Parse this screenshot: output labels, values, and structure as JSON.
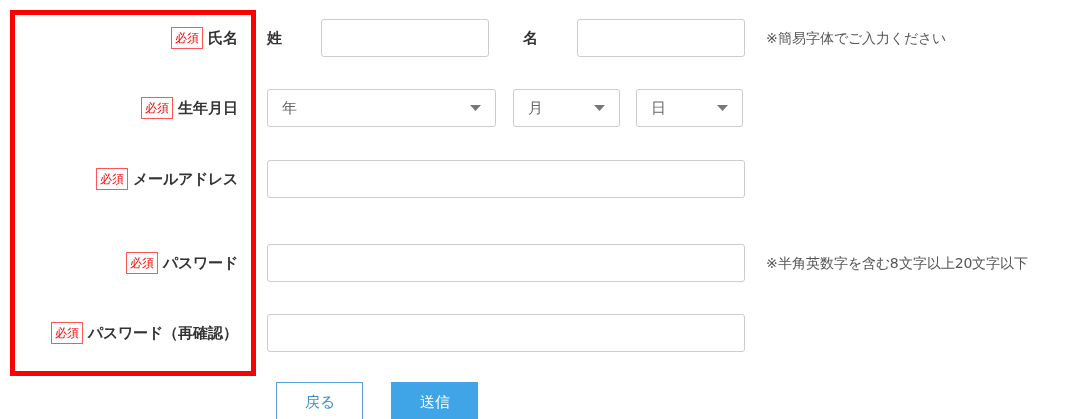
{
  "rows": [
    {
      "kind": "name",
      "required": true,
      "badge": "必須",
      "label": "氏名",
      "fields": [
        {
          "label": "姓"
        },
        {
          "label": "名"
        }
      ],
      "note": "※簡易字体でご入力ください"
    },
    {
      "kind": "date",
      "required": true,
      "badge": "必須",
      "label": "生年月日",
      "selects": [
        {
          "value": "年"
        },
        {
          "value": "月"
        },
        {
          "value": "日"
        }
      ]
    },
    {
      "kind": "text",
      "required": true,
      "badge": "必須",
      "label": "メールアドレス"
    },
    {
      "kind": "text",
      "required": true,
      "badge": "必須",
      "label": "パスワード",
      "note": "※半角英数字を含む8文字以上20文字以下"
    },
    {
      "kind": "text",
      "required": true,
      "badge": "必須",
      "label": "パスワード（再確認）"
    }
  ],
  "buttons": [
    {
      "kind": "back",
      "label": "戻る"
    },
    {
      "kind": "submit",
      "label": "送信"
    }
  ]
}
